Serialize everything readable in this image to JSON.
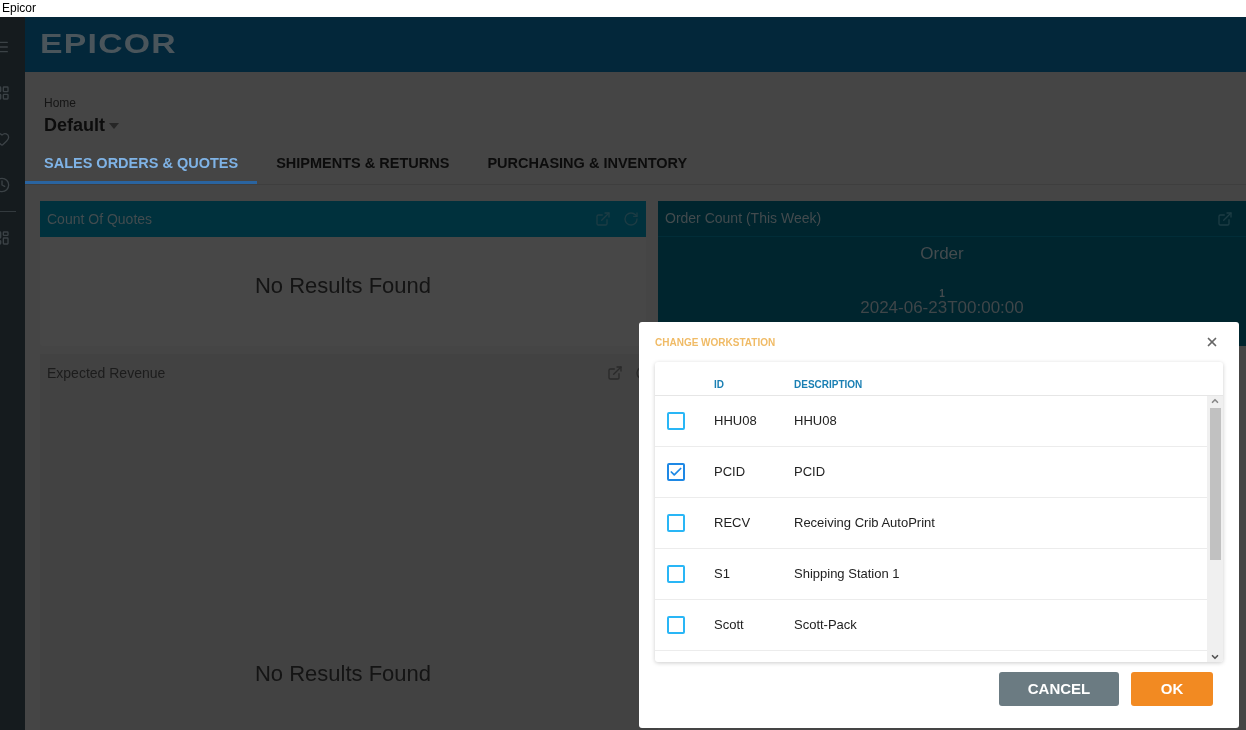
{
  "window": {
    "title": "Epicor"
  },
  "header": {
    "logo": "EPICOR"
  },
  "breadcrumb": "Home",
  "page_title": "Default",
  "tabs": [
    {
      "label": "SALES ORDERS & QUOTES",
      "selected": true
    },
    {
      "label": "SHIPMENTS & RETURNS",
      "selected": false
    },
    {
      "label": "PURCHASING & INVENTORY",
      "selected": false
    }
  ],
  "cards": [
    {
      "title": "Count Of Quotes",
      "message": "No Results Found"
    },
    {
      "title": "Order Count (This Week)",
      "chart_title": "Order",
      "value_label": "1",
      "category_label": "2024-06-23T00:00:00"
    },
    {
      "title": "Expected Revenue",
      "message": "No Results Found"
    }
  ],
  "dialog": {
    "title": "CHANGE WORKSTATION",
    "columns": [
      "ID",
      "DESCRIPTION"
    ],
    "rows": [
      {
        "id": "HHU08",
        "description": "HHU08",
        "selected": false
      },
      {
        "id": "PCID",
        "description": "PCID",
        "selected": true
      },
      {
        "id": "RECV",
        "description": "Receiving Crib AutoPrint",
        "selected": false
      },
      {
        "id": "S1",
        "description": "Shipping Station 1",
        "selected": false
      },
      {
        "id": "Scott",
        "description": "Scott-Pack",
        "selected": false
      }
    ],
    "buttons": [
      {
        "label": "CANCEL",
        "kind": "secondary"
      },
      {
        "label": "OK",
        "kind": "primary"
      }
    ]
  }
}
